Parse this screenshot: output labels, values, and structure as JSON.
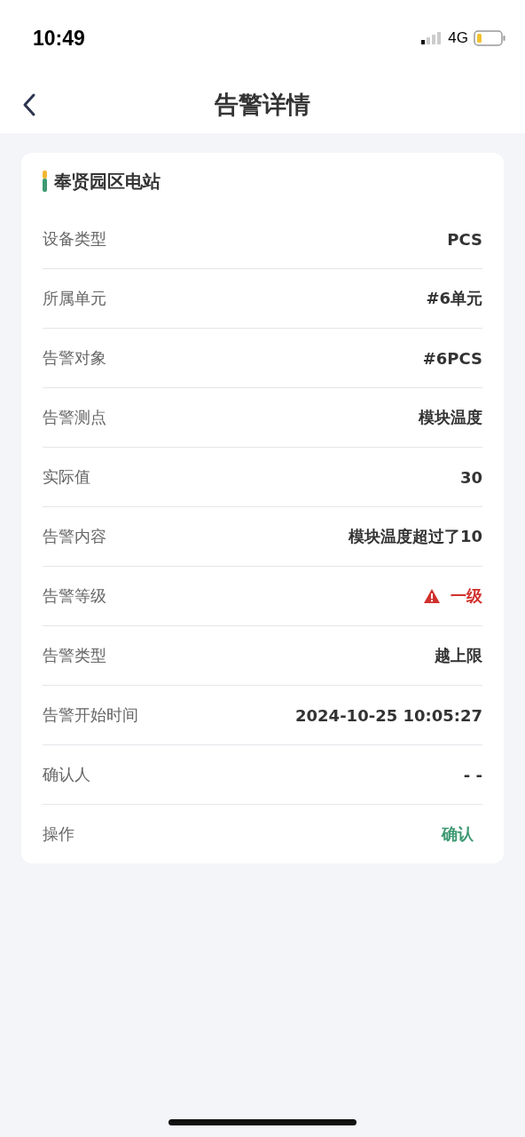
{
  "status_bar": {
    "time": "10:49",
    "network": "4G"
  },
  "nav": {
    "title": "告警详情"
  },
  "card": {
    "title": "奉贤园区电站",
    "rows": [
      {
        "kind": "text",
        "label": "设备类型",
        "value": "PCS"
      },
      {
        "kind": "text",
        "label": "所属单元",
        "value": "#6单元"
      },
      {
        "kind": "text",
        "label": "告警对象",
        "value": "#6PCS"
      },
      {
        "kind": "text",
        "label": "告警测点",
        "value": "模块温度"
      },
      {
        "kind": "text",
        "label": "实际值",
        "value": "30"
      },
      {
        "kind": "text",
        "label": "告警内容",
        "value": "模块温度超过了10"
      },
      {
        "kind": "level",
        "label": "告警等级",
        "value": "一级",
        "color": "#d0312d"
      },
      {
        "kind": "text",
        "label": "告警类型",
        "value": "越上限"
      },
      {
        "kind": "text",
        "label": "告警开始时间",
        "value": "2024-10-25 10:05:27"
      },
      {
        "kind": "text",
        "label": "确认人",
        "value": "- -"
      },
      {
        "kind": "action",
        "label": "操作",
        "value": "确认"
      }
    ]
  }
}
